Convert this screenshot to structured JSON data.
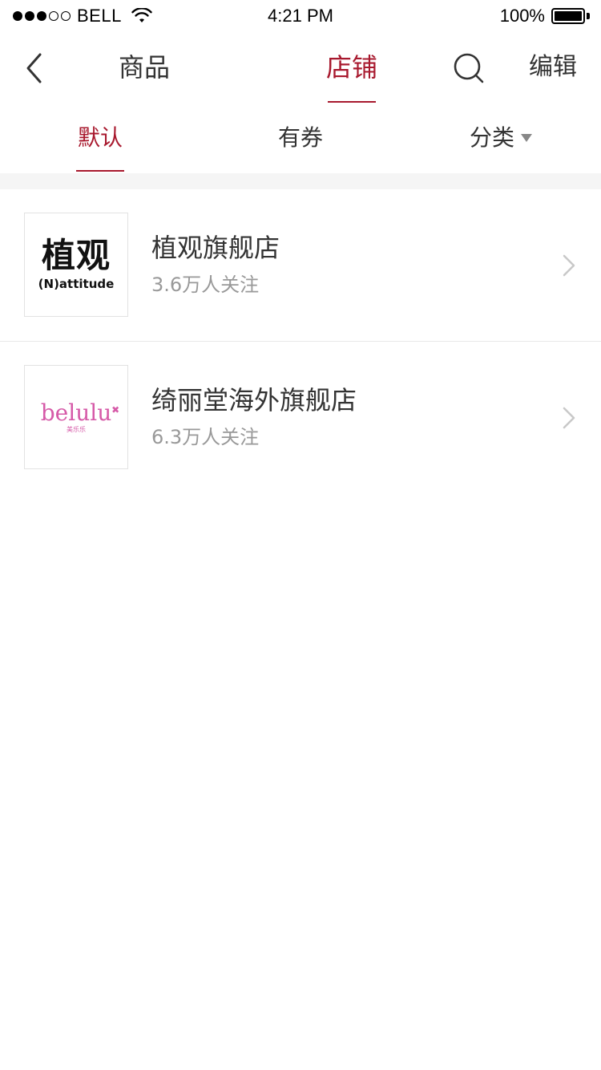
{
  "status_bar": {
    "carrier": "BELL",
    "time": "4:21 PM",
    "battery": "100%",
    "signal_bars_filled": 3,
    "signal_bars_total": 5
  },
  "nav": {
    "tabs": [
      {
        "label": "商品",
        "active": false
      },
      {
        "label": "店铺",
        "active": true
      }
    ],
    "edit_label": "编辑",
    "accent_color": "#a8192e"
  },
  "filters": {
    "tabs": [
      {
        "label": "默认",
        "active": true
      },
      {
        "label": "有券",
        "active": false
      },
      {
        "label": "分类",
        "active": false,
        "has_dropdown": true
      }
    ]
  },
  "stores": [
    {
      "name": "植观旗舰店",
      "followers": "3.6万人关注",
      "logo": {
        "main": "植观",
        "sub": "(N)attitude"
      }
    },
    {
      "name": "绮丽堂海外旗舰店",
      "followers": "6.3万人关注",
      "logo": {
        "main": "belulu",
        "sub": "美乐乐"
      }
    }
  ]
}
